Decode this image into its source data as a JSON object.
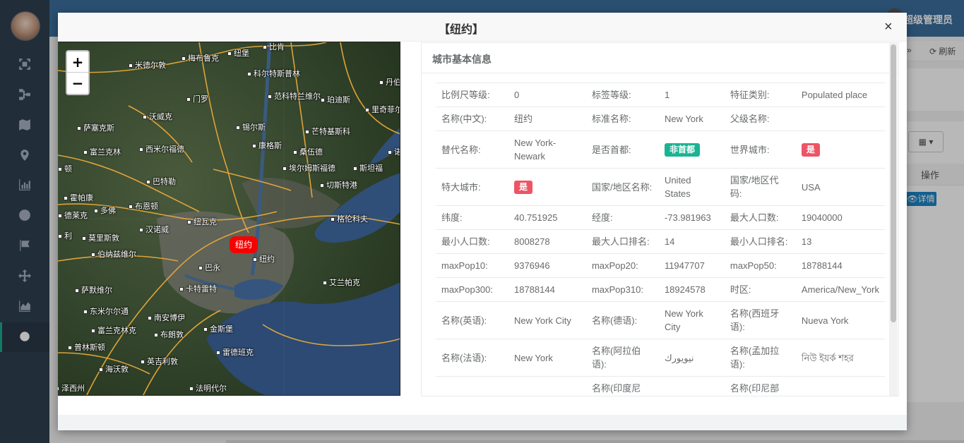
{
  "user": {
    "name": "超级管理员"
  },
  "toolbar": {
    "refresh_label": "刷新",
    "forward_label": "»"
  },
  "table_bg": {
    "op_header": "操作",
    "detail_label": "👁详情",
    "grid_label": "▦ ▾"
  },
  "modal": {
    "title": "【纽约】",
    "close_label": "×"
  },
  "map": {
    "zoom_in": "+",
    "zoom_out": "−",
    "marker_label": "纽约",
    "places": [
      {
        "name": "比肯"
      },
      {
        "name": "纽堡"
      },
      {
        "name": "梅布鲁克"
      },
      {
        "name": "米德尔敦"
      },
      {
        "name": "科尔特斯普林"
      },
      {
        "name": "丹伯"
      },
      {
        "name": "门罗"
      },
      {
        "name": "范科特兰维尔"
      },
      {
        "name": "珀迪斯"
      },
      {
        "name": "里奇菲尔"
      },
      {
        "name": "沃威克"
      },
      {
        "name": "萨塞克斯"
      },
      {
        "name": "锡尔斯"
      },
      {
        "name": "芒特基斯科"
      },
      {
        "name": "富兰克林"
      },
      {
        "name": "西米尔福德"
      },
      {
        "name": "康格斯"
      },
      {
        "name": "桑伍德"
      },
      {
        "name": "诺"
      },
      {
        "name": "顿"
      },
      {
        "name": "埃尔姆斯福德"
      },
      {
        "name": "斯坦福"
      },
      {
        "name": "巴特勒"
      },
      {
        "name": "切斯特港"
      },
      {
        "name": "霍帕康"
      },
      {
        "name": "多佛"
      },
      {
        "name": "布恩顿"
      },
      {
        "name": "德莱克"
      },
      {
        "name": "纽瓦克"
      },
      {
        "name": "汉诺威"
      },
      {
        "name": "利"
      },
      {
        "name": "莫里斯敦"
      },
      {
        "name": "格伦科夫"
      },
      {
        "name": "伯纳兹维尔"
      },
      {
        "name": "纽约"
      },
      {
        "name": "巴永"
      },
      {
        "name": "萨默维尔"
      },
      {
        "name": "卡特雷特"
      },
      {
        "name": "艾兰帕克"
      },
      {
        "name": "东米尔尔通"
      },
      {
        "name": "南安博伊"
      },
      {
        "name": "富兰克林克"
      },
      {
        "name": "布朗敦"
      },
      {
        "name": "金斯堡"
      },
      {
        "name": "普林斯顿"
      },
      {
        "name": "雷德班克"
      },
      {
        "name": "海沃敦"
      },
      {
        "name": "英吉利敦"
      },
      {
        "name": "泽西州"
      },
      {
        "name": "法明代尔"
      }
    ]
  },
  "info": {
    "title": "城市基本信息",
    "rows": [
      [
        {
          "label": "比例尺等级:",
          "value": "0"
        },
        {
          "label": "标签等级:",
          "value": "1"
        },
        {
          "label": "特征类别:",
          "value": "Populated place"
        }
      ],
      [
        {
          "label": "名称(中文):",
          "value": "纽约"
        },
        {
          "label": "标准名称:",
          "value": "New York"
        },
        {
          "label": "父级名称:",
          "value": ""
        }
      ],
      [
        {
          "label": "替代名称:",
          "value": "New York-Newark"
        },
        {
          "label": "是否首都:",
          "badge": "非首都",
          "badge_color": "#1ab394"
        },
        {
          "label": "世界城市:",
          "badge": "是",
          "badge_color": "#ed5565"
        }
      ],
      [
        {
          "label": "特大城市:",
          "badge": "是",
          "badge_color": "#ed5565"
        },
        {
          "label": "国家/地区名称:",
          "value": "United States"
        },
        {
          "label": "国家/地区代码:",
          "value": "USA"
        }
      ],
      [
        {
          "label": "纬度:",
          "value": "40.751925"
        },
        {
          "label": "经度:",
          "value": "-73.981963"
        },
        {
          "label": "最大人口数:",
          "value": "19040000"
        }
      ],
      [
        {
          "label": "最小人口数:",
          "value": "8008278"
        },
        {
          "label": "最大人口排名:",
          "value": "14"
        },
        {
          "label": "最小人口排名:",
          "value": "13"
        }
      ],
      [
        {
          "label": "maxPop10:",
          "value": "9376946"
        },
        {
          "label": "maxPop20:",
          "value": "11947707"
        },
        {
          "label": "maxPop50:",
          "value": "18788144"
        }
      ],
      [
        {
          "label": "maxPop300:",
          "value": "18788144"
        },
        {
          "label": "maxPop310:",
          "value": "18924578"
        },
        {
          "label": "时区:",
          "value": "America/New_York"
        }
      ],
      [
        {
          "label": "名称(英语):",
          "value": "New York City"
        },
        {
          "label": "名称(德语):",
          "value": "New York City"
        },
        {
          "label": "名称(西班牙语):",
          "value": "Nueva York"
        }
      ],
      [
        {
          "label": "名称(法语):",
          "value": "New York"
        },
        {
          "label": "名称(阿拉伯语):",
          "value": "نيويورك"
        },
        {
          "label": "名称(孟加拉语):",
          "value": "নিউ ইয়র্ক শহর"
        }
      ],
      [
        {
          "label": "",
          "value": ""
        },
        {
          "label": "名称(印度尼",
          "value": ""
        },
        {
          "label": "名称(印尼部",
          "value": ""
        }
      ]
    ]
  },
  "colors": {
    "sidebar": "#2f4050",
    "topbar": "#3b6e9c",
    "accent_green": "#1ab394",
    "accent_red": "#ed5565",
    "marker": "#f70000"
  }
}
